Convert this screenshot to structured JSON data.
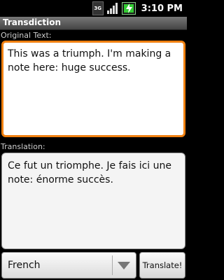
{
  "status_bar": {
    "network": "3G",
    "time": "3:10 PM",
    "icons": [
      "3g-icon",
      "signal-icon",
      "battery-charging-icon"
    ]
  },
  "app": {
    "title": "Transdiction"
  },
  "original": {
    "label": "Original Text:",
    "value": "This was a triumph.  I'm making a note here:  huge success."
  },
  "translation": {
    "label": "Translation:",
    "value": "Ce fut un triomphe. Je fais ici une note: énorme succès."
  },
  "controls": {
    "language": "French",
    "translate_label": "Translate!"
  },
  "colors": {
    "focus": "#f08010",
    "title_bar": "#5a5a5a",
    "battery": "#33cc33"
  }
}
